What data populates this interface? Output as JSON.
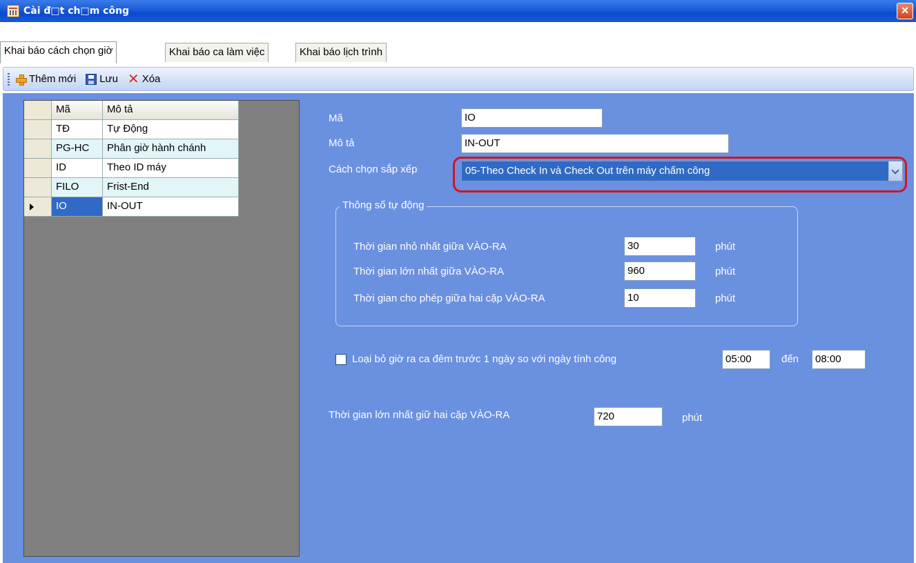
{
  "window": {
    "title": "Cài đ□t ch□m công",
    "title_icon": "calendar-icon",
    "close_label": "×"
  },
  "tabs": [
    {
      "label": "Khai báo cách chọn giờ",
      "active": true
    },
    {
      "label": "Khai báo ca làm việc",
      "active": false
    },
    {
      "label": "Khai báo lịch trình",
      "active": false
    }
  ],
  "toolbar": {
    "add_label": "Thêm mới",
    "add_icon": "add-icon",
    "save_label": "Lưu",
    "save_icon": "save-icon",
    "delete_label": "Xóa",
    "delete_icon": "delete-icon"
  },
  "grid": {
    "columns": [
      "Mã",
      "Mô tả"
    ],
    "rows": [
      {
        "ma": "TĐ",
        "mota": "Tự Động"
      },
      {
        "ma": "PG-HC",
        "mota": "Phân giờ hành chánh"
      },
      {
        "ma": "ID",
        "mota": "Theo ID máy"
      },
      {
        "ma": "FILO",
        "mota": "Frist-End"
      },
      {
        "ma": "IO",
        "mota": "IN-OUT"
      }
    ]
  },
  "form": {
    "ma_label": "Mã",
    "ma_value": "IO",
    "mota_label": "Mô tả",
    "mota_value": "IN-OUT",
    "sort_label": "Cách chọn sắp xếp",
    "sort_value": "05-Theo Check In và Check Out trên máy chấm công",
    "group_title": "Thông số tự động",
    "params": [
      {
        "label": "Thời gian nhỏ nhất giữa VÀO-RA",
        "value": "30",
        "unit": "phút"
      },
      {
        "label": "Thời gian lớn nhất giữa VÀO-RA",
        "value": "960",
        "unit": "phút"
      },
      {
        "label": "Thời gian cho phép giữa hai cặp VÀO-RA",
        "value": "10",
        "unit": "phút"
      }
    ],
    "exclude_label": "Loại bỏ giờ ra ca đêm trước 1 ngày so với ngày tính công",
    "exclude_from": "05:00",
    "exclude_to_label": "đến",
    "exclude_to": "08:00",
    "max_pair_label": "Thời gian lớn nhất giữ hai cặp VÀO-RA",
    "max_pair_value": "720",
    "max_pair_unit": "phút"
  },
  "colors": {
    "panel_bg": "#6a90e0",
    "selection": "#316ac5",
    "highlight_outline": "#d4141c"
  }
}
